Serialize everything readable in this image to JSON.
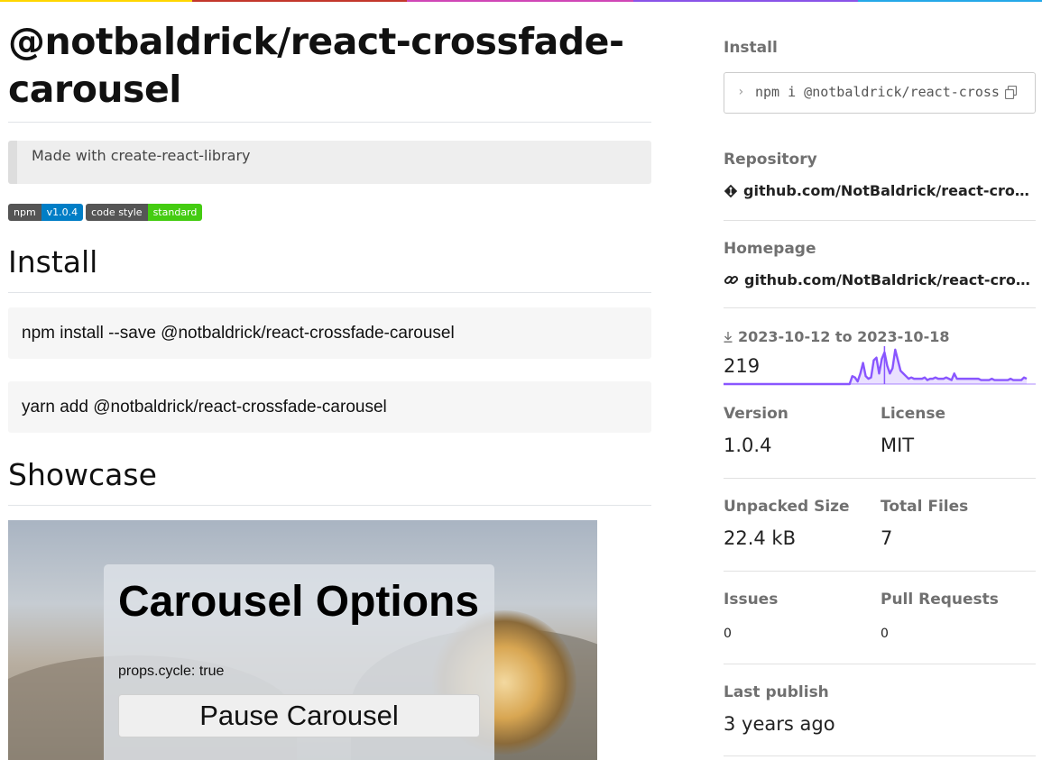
{
  "colors": {
    "topbar": [
      "#ffd600",
      "#c3372b",
      "#d046b6",
      "#8953e8",
      "#24a8e8"
    ],
    "npm_badge_left": "#555555",
    "npm_badge_right": "#007ec6",
    "style_badge_right": "#44cc11",
    "sparkline": "#8956ff"
  },
  "package": {
    "title": "@notbaldrick/react-crossfade-carousel",
    "tagline": "Made with create-react-library"
  },
  "badges": [
    {
      "left": "npm",
      "right": "v1.0.4"
    },
    {
      "left": "code style",
      "right": "standard"
    }
  ],
  "readme": {
    "install_heading": "Install",
    "npm_cmd": "npm install --save @notbaldrick/react-crossfade-carousel",
    "yarn_cmd": "yarn add @notbaldrick/react-crossfade-carousel",
    "showcase_heading": "Showcase",
    "demo": {
      "title": "Carousel Options",
      "prop": "props.cycle: true",
      "button": "Pause Carousel"
    }
  },
  "sidebar": {
    "install_label": "Install",
    "install_prompt": "›",
    "install_cmd": "npm i @notbaldrick/react-crossfade-carousel",
    "repository_label": "Repository",
    "repository_url": "github.com/NotBaldrick/react-crossfade-carousel",
    "homepage_label": "Homepage",
    "homepage_url": "github.com/NotBaldrick/react-crossfade-carousel#readme",
    "downloads_icon": "download-icon",
    "downloads_range": "2023-10-12 to 2023-10-18",
    "downloads_count": "219",
    "version_label": "Version",
    "version": "1.0.4",
    "license_label": "License",
    "license": "MIT",
    "unpacked_label": "Unpacked Size",
    "unpacked": "22.4 kB",
    "files_label": "Total Files",
    "files": "7",
    "issues_label": "Issues",
    "issues": "0",
    "prs_label": "Pull Requests",
    "prs": "0",
    "publish_label": "Last publish",
    "publish": "3 years ago"
  },
  "chart_data": {
    "type": "area",
    "title": "",
    "xlabel": "",
    "ylabel": "",
    "values": [
      0,
      0,
      0,
      0,
      0,
      0,
      0,
      0,
      0,
      0,
      0,
      0,
      0,
      0,
      0,
      0,
      0,
      0,
      0,
      0,
      0,
      0,
      0,
      0,
      0,
      0,
      0,
      0,
      0,
      0,
      0,
      0,
      0,
      0,
      0,
      0,
      0,
      0,
      0,
      0,
      0,
      0,
      0,
      0,
      0,
      0,
      0,
      0,
      6,
      5,
      2,
      8,
      16,
      6,
      4,
      5,
      18,
      20,
      8,
      19,
      24,
      14,
      8,
      12,
      26,
      18,
      10,
      8,
      6,
      4,
      5,
      4,
      4,
      4,
      4,
      5,
      3,
      4,
      4,
      5,
      4,
      4,
      4,
      5,
      4,
      3,
      8,
      4,
      4,
      4,
      4,
      4,
      4,
      4,
      4,
      4,
      3,
      3,
      3,
      3,
      4,
      3,
      3,
      3,
      3,
      3,
      3,
      4,
      3,
      3,
      3,
      3,
      5,
      4
    ],
    "ylim": [
      0,
      30
    ]
  }
}
